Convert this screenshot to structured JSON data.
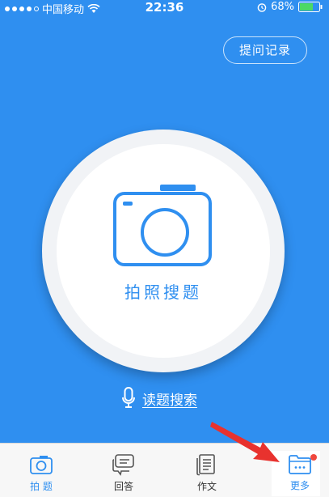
{
  "status_bar": {
    "carrier": "中国移动",
    "time": "22:36",
    "battery": "68%"
  },
  "header": {
    "history_button": "提问记录"
  },
  "main": {
    "photo_search_label": "拍照搜题",
    "voice_search_label": "读题搜索"
  },
  "tabs": [
    {
      "label": "拍 题",
      "icon": "camera-icon",
      "active": true
    },
    {
      "label": "回答",
      "icon": "chat-icon",
      "active": false
    },
    {
      "label": "作文",
      "icon": "document-icon",
      "active": false
    },
    {
      "label": "更多",
      "icon": "folder-more-icon",
      "active": false
    }
  ],
  "colors": {
    "primary": "#2f8ff0",
    "badge": "#f0483e",
    "arrow": "#e8322e",
    "battery_fill": "#4cd964"
  }
}
